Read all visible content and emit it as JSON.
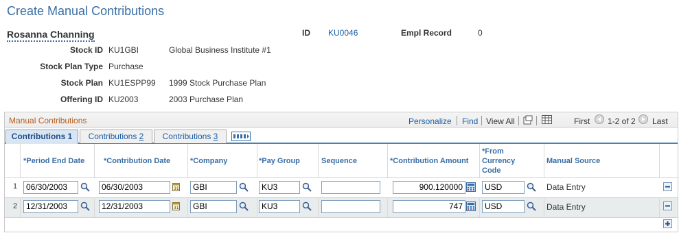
{
  "page": {
    "title": "Create Manual Contributions"
  },
  "employee": {
    "name": "Rosanna Channing",
    "id_label": "ID",
    "id_value": "KU0046",
    "empl_record_label": "Empl Record",
    "empl_record_value": "0"
  },
  "details": [
    {
      "label": "Stock ID",
      "code": "KU1GBI",
      "desc": "Global Business Institute #1"
    },
    {
      "label": "Stock Plan Type",
      "code": "Purchase",
      "desc": ""
    },
    {
      "label": "Stock Plan",
      "code": "KU1ESPP99",
      "desc": "1999 Stock Purchase Plan"
    },
    {
      "label": "Offering ID",
      "code": "KU2003",
      "desc": "2003 Purchase Plan"
    }
  ],
  "grid": {
    "title": "Manual Contributions",
    "personalize": "Personalize",
    "find": "Find",
    "view_all": "View All",
    "first": "First",
    "range": "1-2 of 2",
    "last": "Last",
    "tabs": [
      {
        "pre": "Contributions ",
        "num": "1"
      },
      {
        "pre": "Contributions ",
        "num": "2"
      },
      {
        "pre": "Contributions ",
        "num": "3"
      }
    ],
    "columns": [
      "*Period End Date",
      "*Contribution Date",
      "*Company",
      "*Pay Group",
      "Sequence",
      "*Contribution Amount",
      "*From Currency Code",
      "Manual Source"
    ],
    "rows": [
      {
        "num": "1",
        "period_end": "06/30/2003",
        "contrib_date": "06/30/2003",
        "company": "GBI",
        "pay_group": "KU3",
        "sequence": "",
        "amount": "900.120000",
        "currency": "USD",
        "source": "Data Entry"
      },
      {
        "num": "2",
        "period_end": "12/31/2003",
        "contrib_date": "12/31/2003",
        "company": "GBI",
        "pay_group": "KU3",
        "sequence": "",
        "amount": "747",
        "currency": "USD",
        "source": "Data Entry"
      }
    ],
    "colors": {
      "header_text": "#3a6ea5",
      "title_text": "#b35d1e",
      "alt_row": "#e8ecec"
    }
  }
}
